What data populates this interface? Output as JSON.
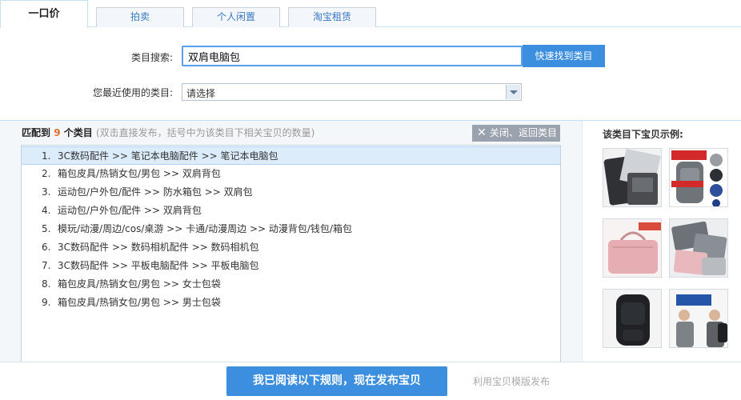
{
  "tabs": [
    {
      "label": "一口价",
      "active": true
    },
    {
      "label": "拍卖",
      "active": false
    },
    {
      "label": "个人闲置",
      "active": false
    },
    {
      "label": "淘宝租赁",
      "active": false
    }
  ],
  "search": {
    "label": "类目搜索:",
    "value": "双肩电脑包",
    "button_label": "快速找到类目"
  },
  "recent": {
    "label": "您最近使用的类目:",
    "selected": "请选择"
  },
  "matches": {
    "prefix": "匹配到",
    "count": "9",
    "suffix": "个类目",
    "hint": "(双击直接发布，括号中为该类目下相关宝贝的数量)",
    "close_label": "关闭、返回类目"
  },
  "categories": [
    {
      "num": "1.",
      "path": "3C数码配件 >> 笔记本电脑配件 >> 笔记本电脑包",
      "selected": true
    },
    {
      "num": "2.",
      "path": "箱包皮具/热销女包/男包 >> 双肩背包",
      "selected": false
    },
    {
      "num": "3.",
      "path": "运动包/户外包/配件 >> 防水箱包 >> 双肩包",
      "selected": false
    },
    {
      "num": "4.",
      "path": "运动包/户外包/配件 >> 双肩背包",
      "selected": false
    },
    {
      "num": "5.",
      "path": "模玩/动漫/周边/cos/桌游 >> 卡通/动漫周边 >> 动漫背包/钱包/箱包",
      "selected": false
    },
    {
      "num": "6.",
      "path": "3C数码配件 >> 数码相机配件 >> 数码相机包",
      "selected": false
    },
    {
      "num": "7.",
      "path": "3C数码配件 >> 平板电脑配件 >> 平板电脑包",
      "selected": false
    },
    {
      "num": "8.",
      "path": "箱包皮具/热销女包/男包 >> 女士包袋",
      "selected": false
    },
    {
      "num": "9.",
      "path": "箱包皮具/热销女包/男包 >> 男士包袋",
      "selected": false
    }
  ],
  "examples": {
    "title": "该类目下宝贝示例:",
    "items": [
      {
        "name": "laptop-sleeve-dark"
      },
      {
        "name": "grey-backpack-red-banner"
      },
      {
        "name": "pink-laptop-bag"
      },
      {
        "name": "grey-and-pink-laptop-bags"
      },
      {
        "name": "black-backpack"
      },
      {
        "name": "man-with-backpack"
      }
    ]
  },
  "footer": {
    "publish_label": "我已阅读以下规则，现在发布宝贝",
    "template_label": "利用宝贝模版发布"
  },
  "colors": {
    "accent": "#3c8ede",
    "count": "#e3702f",
    "selected_row": "#dcecfb"
  }
}
